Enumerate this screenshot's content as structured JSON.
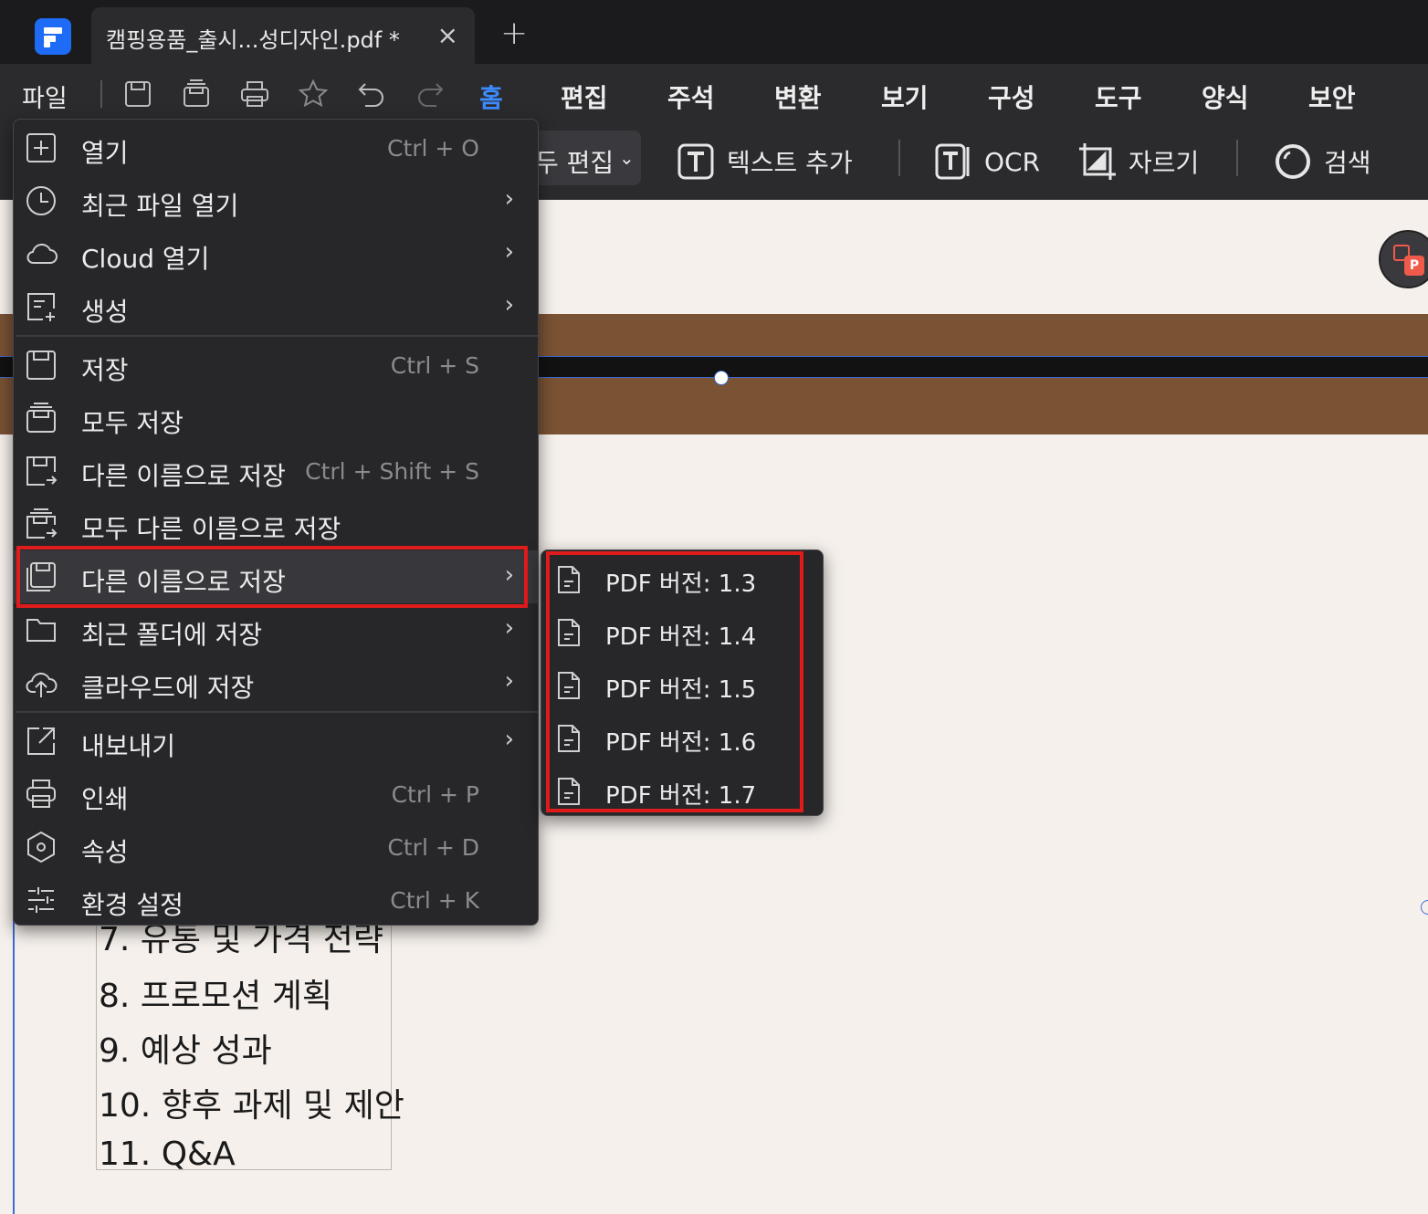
{
  "window": {
    "tab_title": "캠핑용품_출시...성디자인.pdf *",
    "tab_close": "×",
    "new_tab": "+"
  },
  "menubar": {
    "file_label": "파일",
    "tabs": [
      {
        "label": "홈",
        "active": true
      },
      {
        "label": "편집"
      },
      {
        "label": "주석"
      },
      {
        "label": "변환"
      },
      {
        "label": "보기"
      },
      {
        "label": "구성"
      },
      {
        "label": "도구"
      },
      {
        "label": "양식"
      },
      {
        "label": "보안"
      }
    ]
  },
  "toolbar": {
    "edit_all": "두 편집",
    "add_text": "텍스트 추가",
    "ocr": "OCR",
    "crop": "자르기",
    "search": "검색"
  },
  "file_menu": {
    "items": [
      {
        "label": "열기",
        "shortcut": "Ctrl + O",
        "icon": "plus-square-icon"
      },
      {
        "label": "최근 파일 열기",
        "submenu": true,
        "icon": "clock-icon"
      },
      {
        "label": "Cloud 열기",
        "submenu": true,
        "icon": "cloud-icon"
      },
      {
        "label": "생성",
        "submenu": true,
        "icon": "create-icon"
      },
      {
        "label": "저장",
        "shortcut": "Ctrl + S",
        "icon": "save-icon"
      },
      {
        "label": "모두 저장",
        "icon": "save-all-icon"
      },
      {
        "label": "다른 이름으로 저장",
        "shortcut": "Ctrl + Shift + S",
        "icon": "save-as-icon"
      },
      {
        "label": "모두 다른 이름으로 저장",
        "icon": "save-all-as-icon"
      },
      {
        "label": "다른 이름으로 저장",
        "submenu": true,
        "icon": "save-as-version-icon",
        "highlighted": true
      },
      {
        "label": "최근 폴더에 저장",
        "submenu": true,
        "icon": "folder-icon"
      },
      {
        "label": "클라우드에 저장",
        "submenu": true,
        "icon": "cloud-upload-icon"
      },
      {
        "label": "내보내기",
        "submenu": true,
        "icon": "export-icon"
      },
      {
        "label": "인쇄",
        "shortcut": "Ctrl + P",
        "icon": "print-icon"
      },
      {
        "label": "속성",
        "shortcut": "Ctrl + D",
        "icon": "properties-icon"
      },
      {
        "label": "환경 설정",
        "shortcut": "Ctrl + K",
        "icon": "settings-icon"
      }
    ],
    "submenu_arrow": "›"
  },
  "version_submenu": {
    "items": [
      {
        "label": "PDF 버전: 1.3"
      },
      {
        "label": "PDF 버전: 1.4"
      },
      {
        "label": "PDF 버전: 1.5"
      },
      {
        "label": "PDF 버전: 1.6"
      },
      {
        "label": "PDF 버전: 1.7"
      }
    ]
  },
  "document": {
    "agenda": [
      "7. 유통 및 가격 전략",
      "8. 프로모션 계획",
      "9. 예상 성과",
      "10. 향후 과제 및 제안",
      "11. Q&A"
    ]
  },
  "colors": {
    "accent": "#3d8bff",
    "highlight_border": "#e01b1b",
    "brown_band": "#7a5234",
    "page_bg": "#f5f0ec"
  }
}
